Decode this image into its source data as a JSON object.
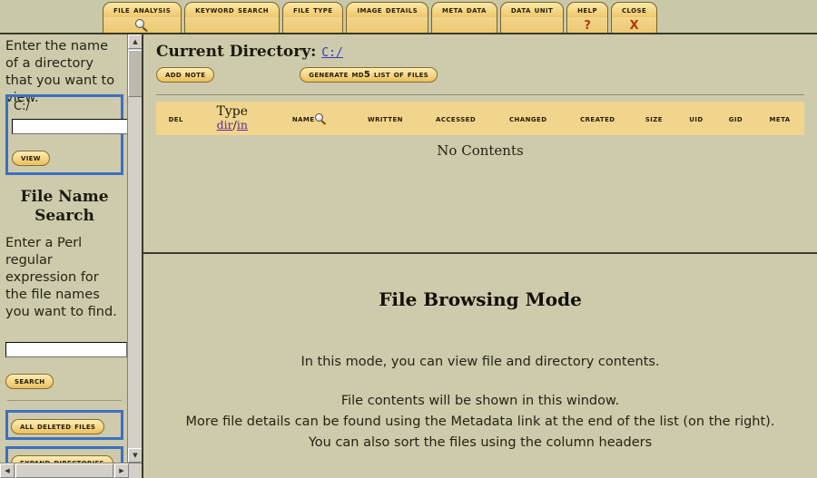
{
  "topnav": {
    "tabs": [
      {
        "label": "File Analysis",
        "glyph": "magnifier",
        "name": "tab-file-analysis"
      },
      {
        "label": "Keyword Search",
        "glyph": "",
        "name": "tab-keyword-search"
      },
      {
        "label": "File Type",
        "glyph": "",
        "name": "tab-file-type"
      },
      {
        "label": "Image Details",
        "glyph": "",
        "name": "tab-image-details"
      },
      {
        "label": "Meta Data",
        "glyph": "",
        "name": "tab-meta-data"
      },
      {
        "label": "Data Unit",
        "glyph": "",
        "name": "tab-data-unit"
      },
      {
        "label": "Help",
        "glyph": "?",
        "name": "tab-help"
      },
      {
        "label": "Close",
        "glyph": "X",
        "name": "tab-close"
      }
    ]
  },
  "sidebar": {
    "directory_prompt": "Enter the name of a directory that you want to view.",
    "current_path": "C:/",
    "directory_input_value": "",
    "view_button": "View",
    "search_heading_line1": "File Name",
    "search_heading_line2": "Search",
    "search_prompt": "Enter a Perl regular expression for the file names you want to find.",
    "search_input_value": "",
    "search_button": "Search",
    "all_deleted_files_button": "All Deleted Files",
    "expand_directories_button": "Expand Directories"
  },
  "main": {
    "current_directory_label": "Current Directory:",
    "current_directory_value": "C:/",
    "add_note_button": "Add Note",
    "generate_md5_button": "Generate MD5 List of Files",
    "table": {
      "columns": [
        "Del",
        "Type",
        "Name",
        "Written",
        "Accessed",
        "Changed",
        "Created",
        "Size",
        "UID",
        "GID",
        "Meta"
      ],
      "type_sub_links": [
        "dir",
        "in"
      ],
      "type_separator": "/",
      "empty_message": "No Contents",
      "rows": []
    }
  },
  "info_panel": {
    "title": "File Browsing Mode",
    "lines": [
      "In this mode, you can view file and directory contents.",
      "File contents will be shown in this window.",
      "More file details can be found using the Metadata link at the end of the list (on the right).",
      "You can also sort the files using the column headers"
    ]
  },
  "colors": {
    "page_background": "#cdcbab",
    "tab_gold": "#f2d58c",
    "highlight_blue": "#3d6fc4",
    "link_blue": "#3a3ac0",
    "link_purple": "#5a2aa8",
    "accent_red": "#b03a12"
  },
  "scrollbars": {
    "vertical_up": "▲",
    "vertical_down": "▼",
    "horizontal_left": "◀",
    "horizontal_right": "▶"
  }
}
